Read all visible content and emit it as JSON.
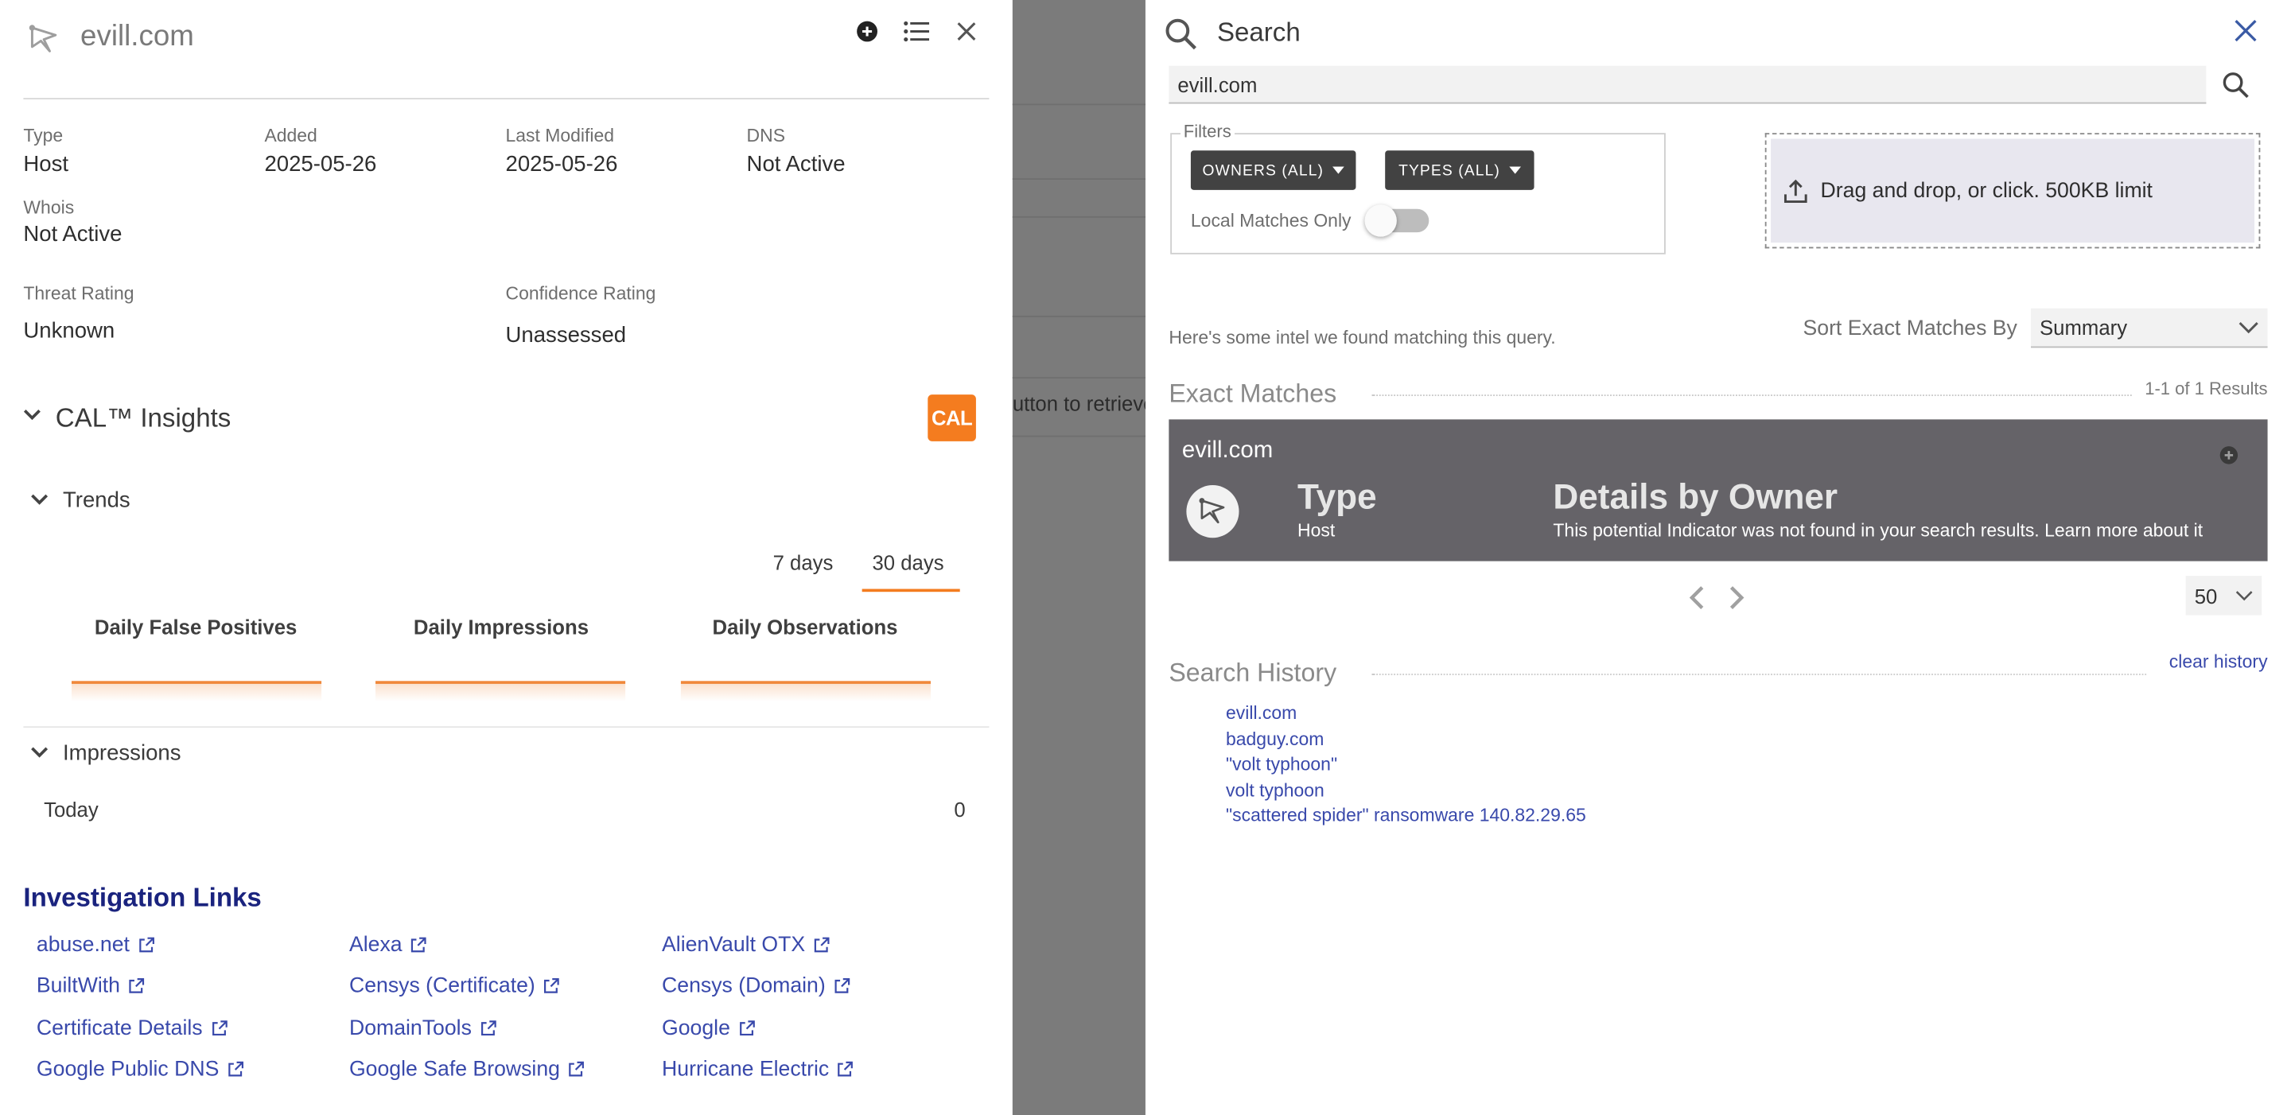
{
  "indicator_panel": {
    "title": "evill.com",
    "meta": {
      "type_label": "Type",
      "type_value": "Host",
      "added_label": "Added",
      "added_value": "2025-05-26",
      "modified_label": "Last Modified",
      "modified_value": "2025-05-26",
      "dns_label": "DNS",
      "dns_value": "Not Active",
      "whois_label": "Whois",
      "whois_value": "Not Active",
      "threat_label": "Threat Rating",
      "threat_value": "Unknown",
      "confidence_label": "Confidence Rating",
      "confidence_value": "Unassessed"
    },
    "cal": {
      "title": "CAL™ Insights",
      "badge": "CAL"
    },
    "trends": {
      "title": "Trends",
      "ranges": [
        "7 days",
        "30 days"
      ],
      "active_range": "30 days",
      "metrics": [
        "Daily False Positives",
        "Daily Impressions",
        "Daily Observations"
      ]
    },
    "impressions": {
      "title": "Impressions",
      "today_label": "Today",
      "today_value": "0"
    },
    "investigation": {
      "title": "Investigation Links",
      "links": [
        "abuse.net",
        "Alexa",
        "AlienVault OTX",
        "BuiltWith",
        "Censys (Certificate)",
        "Censys (Domain)",
        "Certificate Details",
        "DomainTools",
        "Google",
        "Google Public DNS",
        "Google Safe Browsing",
        "Hurricane Electric"
      ]
    }
  },
  "background_fragment": {
    "text": "utton to retrieve"
  },
  "search_panel": {
    "title": "Search",
    "query": "evill.com",
    "filters": {
      "legend": "Filters",
      "owners_btn": "OWNERS (ALL)",
      "types_btn": "TYPES (ALL)",
      "local_label": "Local Matches Only",
      "local_on": false
    },
    "upload": {
      "text": "Drag and drop, or click. 500KB limit"
    },
    "intel_note": "Here's some intel we found matching this query.",
    "sort": {
      "label": "Sort Exact Matches By",
      "value": "Summary"
    },
    "exact": {
      "title": "Exact Matches",
      "count": "1-1 of 1 Results",
      "card": {
        "name": "evill.com",
        "type_heading": "Type",
        "type_value": "Host",
        "details_heading": "Details by Owner",
        "details_text": "This potential Indicator was not found in your search results. Learn more about it"
      },
      "per_page": "50"
    },
    "history": {
      "title": "Search History",
      "clear": "clear history",
      "items": [
        "evill.com",
        "badguy.com",
        "\"volt typhoon\"",
        "volt typhoon",
        "\"scattered spider\" ransomware 140.82.29.65"
      ]
    }
  },
  "colors": {
    "accent": "#f47c1f",
    "link": "#3949ab",
    "heading": "#1a237e",
    "card": "#656368",
    "button": "#424242"
  }
}
